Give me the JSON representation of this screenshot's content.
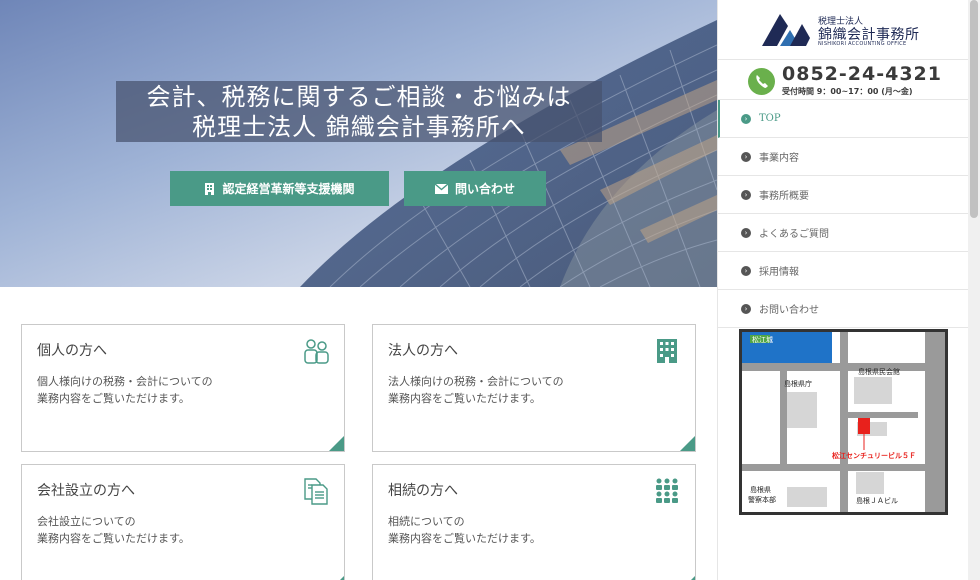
{
  "hero": {
    "title_line1": "会計、税務に関するご相談・お悩みは",
    "title_line2": "税理士法人 錦織会計事務所へ",
    "btn_support": "認定経営革新等支援機関",
    "btn_contact": "問い合わせ"
  },
  "cards": [
    {
      "title": "個人の方へ",
      "desc1": "個人様向けの税務・会計についての",
      "desc2": "業務内容をご覧いただけます。",
      "icon": "people-icon"
    },
    {
      "title": "法人の方へ",
      "desc1": "法人様向けの税務・会計についての",
      "desc2": "業務内容をご覧いただけます。",
      "icon": "building-icon"
    },
    {
      "title": "会社設立の方へ",
      "desc1": "会社設立についての",
      "desc2": "業務内容をご覧いただけます。",
      "icon": "documents-icon"
    },
    {
      "title": "相続の方へ",
      "desc1": "相続についての",
      "desc2": "業務内容をご覧いただけます。",
      "icon": "family-icon"
    }
  ],
  "sidebar": {
    "logo_sub": "税理士法人",
    "logo_name": "錦織会計事務所",
    "logo_en": "NISHIKORI ACCOUNTING OFFICE",
    "phone": "0852-24-4321",
    "hours": "受付時間 9：00~17：00 (月～金)",
    "nav": [
      "TOP",
      "事業内容",
      "事務所概要",
      "よくあるご質問",
      "採用情報",
      "お問い合わせ"
    ]
  },
  "map": {
    "castle": "松江城",
    "pref_office": "島根県庁",
    "hall": "島根県民会館",
    "building": "松江センチュリービル５Ｆ",
    "police_1": "島根県",
    "police_2": "警察本部",
    "ja": "島根ＪＡビル"
  },
  "colors": {
    "accent": "#4a9a87",
    "phone_green": "#6ab04c",
    "logo_navy": "#1f2a55"
  }
}
